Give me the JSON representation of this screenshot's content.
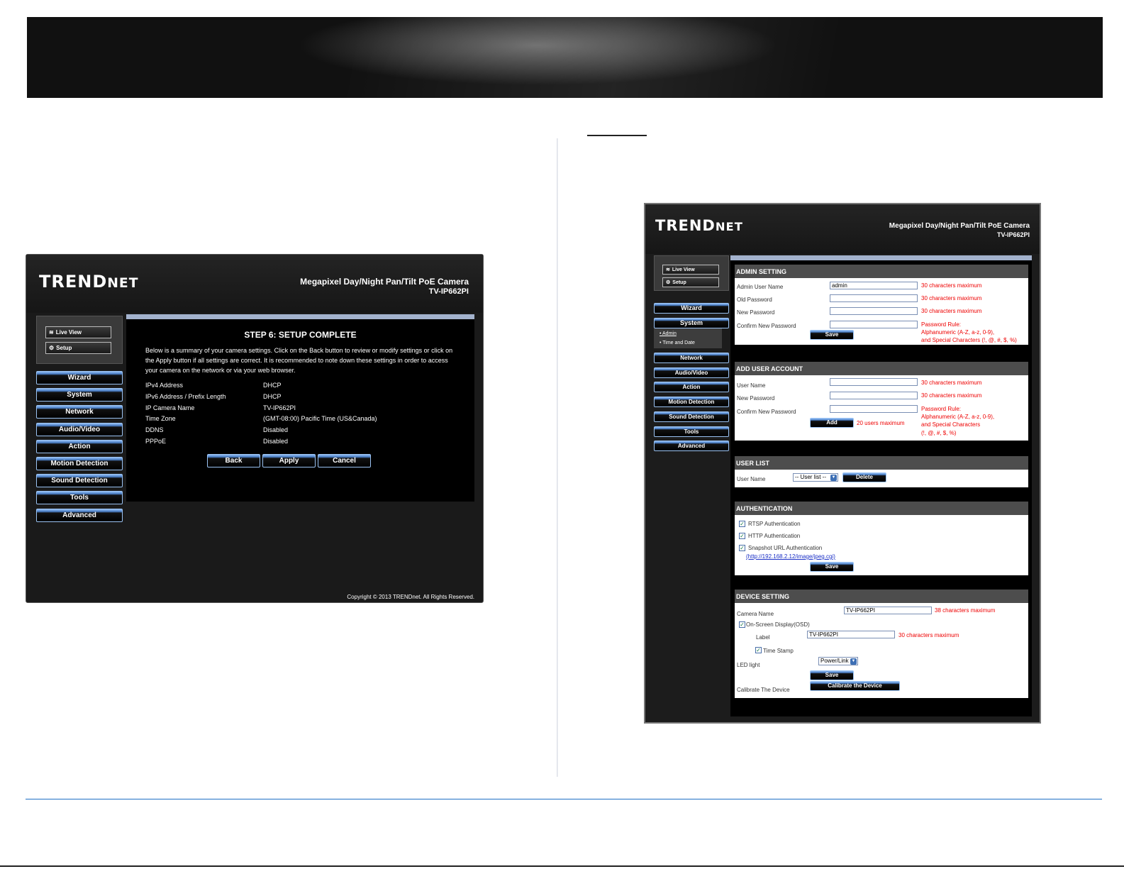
{
  "left_window": {
    "brand": {
      "main": "TREND",
      "suffix": "NET"
    },
    "model_title": "Megapixel Day/Night Pan/Tilt PoE Camera",
    "model_sub": "TV-IP662PI",
    "live_view": "Live View",
    "setup": "Setup",
    "nav": [
      "Wizard",
      "System",
      "Network",
      "Audio/Video",
      "Action",
      "Motion Detection",
      "Sound Detection",
      "Tools",
      "Advanced"
    ],
    "step_title": "STEP 6: SETUP COMPLETE",
    "intro": "Below is a summary of your camera settings. Click on the Back button to review or modify settings or click on the Apply button if all settings are correct. It is recommended to note down these settings in order to access your camera on the network or via your web browser.",
    "summary": [
      {
        "key": "IPv4 Address",
        "value": "DHCP"
      },
      {
        "key": "IPv6 Address / Prefix Length",
        "value": "DHCP"
      },
      {
        "key": "IP Camera Name",
        "value": "TV-IP662PI"
      },
      {
        "key": "Time Zone",
        "value": "(GMT-08:00) Pacific Time (US&Canada)"
      },
      {
        "key": "DDNS",
        "value": "Disabled"
      },
      {
        "key": "PPPoE",
        "value": "Disabled"
      }
    ],
    "buttons": {
      "back": "Back",
      "apply": "Apply",
      "cancel": "Cancel"
    },
    "copyright": "Copyright © 2013 TRENDnet. All Rights Reserved."
  },
  "right_window": {
    "brand": {
      "main": "TREND",
      "suffix": "NET"
    },
    "model_title": "Megapixel Day/Night Pan/Tilt PoE Camera",
    "model_sub": "TV-IP662PI",
    "live_view": "Live View",
    "setup": "Setup",
    "nav": {
      "wizard": "Wizard",
      "system": "System",
      "system_sub": [
        "• Admin",
        "• Time and Date"
      ],
      "rest": [
        "Network",
        "Audio/Video",
        "Action",
        "Motion Detection",
        "Sound Detection",
        "Tools",
        "Advanced"
      ]
    },
    "admin": {
      "title": "ADMIN SETTING",
      "labels": [
        "Admin User Name",
        "Old Password",
        "New Password",
        "Confirm New Password"
      ],
      "admin_value": "admin",
      "hint": "30 characters maximum",
      "password_rule": [
        "Password Rule:",
        "Alphanumeric (A-Z, a-z, 0-9),",
        "and Special Characters   (!, @, #, $, %)"
      ],
      "save": "Save"
    },
    "add_user": {
      "title": "ADD USER ACCOUNT",
      "labels": [
        "User Name",
        "New Password",
        "Confirm New Password"
      ],
      "hint": "30 characters maximum",
      "password_rule": [
        "Password Rule:",
        "Alphanumeric (A-Z, a-z, 0-9),",
        "and Special Characters",
        "(!, @, #, $, %)"
      ],
      "add": "Add",
      "users_max": "20 users maximum"
    },
    "user_list": {
      "title": "USER LIST",
      "label": "User Name",
      "select": "-- User list --",
      "delete": "Delete"
    },
    "auth": {
      "title": "AUTHENTICATION",
      "items": [
        "RTSP Authentication",
        "HTTP Authentication",
        "Snapshot URL Authentication"
      ],
      "url": "(http://192.168.2.12/image/jpeg.cgi)",
      "save": "Save"
    },
    "device": {
      "title": "DEVICE SETTING",
      "camera_name_label": "Camera Name",
      "camera_name_value": "TV-IP662PI",
      "camera_name_hint": "38 characters maximum",
      "osd_label": "On-Screen Display(OSD)",
      "label_label": "Label",
      "label_value": "TV-IP662PI",
      "label_hint": "30 characters maximum",
      "time_stamp": "Time Stamp",
      "led_label": "LED light",
      "led_value": "Power/Link",
      "save": "Save",
      "calibrate_label": "Calibrate The Device",
      "calibrate_button": "Calibrate the Device"
    }
  },
  "colors": {
    "accent_blue": "#4a7fc8",
    "hint_red": "#e00000",
    "footer_line": "#1f6fc4"
  }
}
